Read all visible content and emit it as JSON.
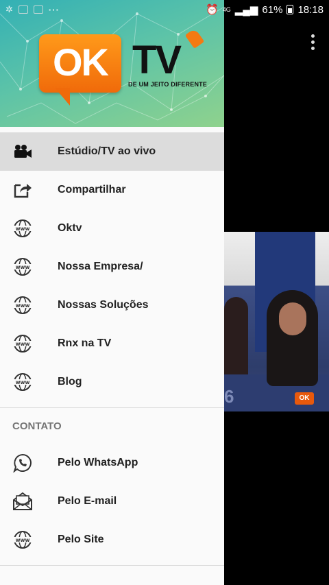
{
  "status_bar": {
    "battery": "61%",
    "time": "18:18",
    "network": "4G"
  },
  "header": {
    "logo_ok": "OK",
    "logo_tv": "TV",
    "tagline": "DE UM JEITO DIFERENTE"
  },
  "menu": [
    {
      "label": "Estúdio/TV ao vivo",
      "icon": "video-camera-icon"
    },
    {
      "label": "Compartilhar",
      "icon": "share-icon"
    },
    {
      "label": "Oktv",
      "icon": "www-globe-icon"
    },
    {
      "label": "Nossa Empresa/",
      "icon": "www-globe-icon"
    },
    {
      "label": "Nossas Soluções",
      "icon": "www-globe-icon"
    },
    {
      "label": "Rnx na TV",
      "icon": "www-globe-icon"
    },
    {
      "label": "Blog",
      "icon": "www-globe-icon"
    }
  ],
  "contact_section": {
    "title": "CONTATO",
    "items": [
      {
        "label": "Pelo WhatsApp",
        "icon": "whatsapp-icon"
      },
      {
        "label": "Pelo E-mail",
        "icon": "email-icon"
      },
      {
        "label": "Pelo Site",
        "icon": "www-globe-icon"
      }
    ]
  },
  "video": {
    "bug": "OK",
    "number": "6"
  },
  "colors": {
    "orange": "#f06a0a",
    "header_start": "#33b0b5",
    "header_end": "#8fd28d",
    "active_row": "#dcdcdc"
  }
}
